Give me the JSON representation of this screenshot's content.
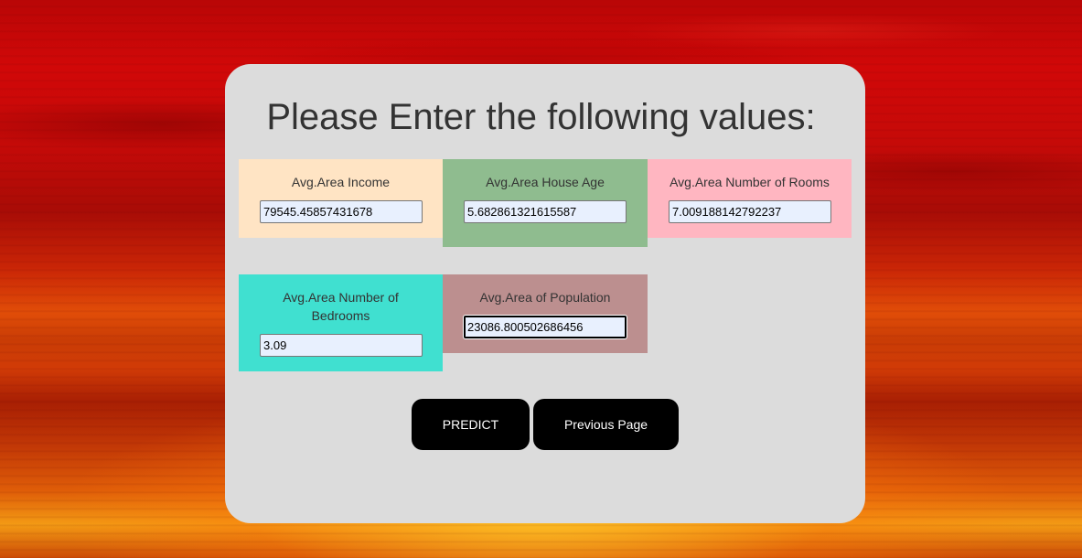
{
  "form": {
    "title": "Please Enter the following values:",
    "fields": [
      {
        "label": "Avg.Area Income",
        "value": "79545.45857431678",
        "bg": "#ffe4c4"
      },
      {
        "label": "Avg.Area House Age",
        "value": "5.682861321615587",
        "bg": "#8fbc8f"
      },
      {
        "label": "Avg.Area Number of Rooms",
        "value": "7.009188142792237",
        "bg": "#ffb6c1"
      },
      {
        "label": "Avg.Area Number of Bedrooms",
        "value": "3.09",
        "bg": "#40e0d0"
      },
      {
        "label": "Avg.Area of Population",
        "value": "23086.800502686456",
        "bg": "#bc8f8f"
      }
    ],
    "buttons": {
      "predict": "PREDICT",
      "previous": "Previous Page"
    }
  },
  "colors": {
    "card": "#dcdcdc",
    "button": "#000000",
    "input_bg": "#e8f0fe"
  }
}
